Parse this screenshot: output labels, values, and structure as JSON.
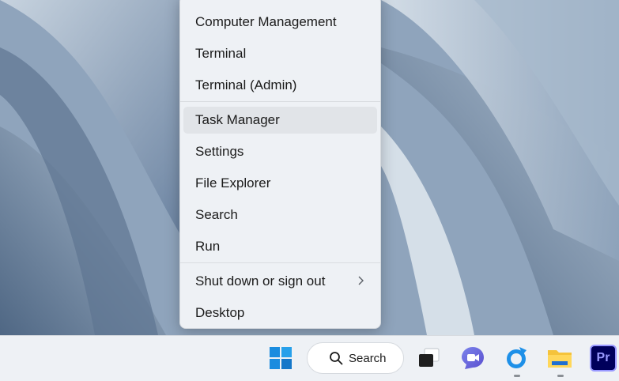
{
  "menu": {
    "items": [
      {
        "label": "Computer Management"
      },
      {
        "label": "Terminal"
      },
      {
        "label": "Terminal (Admin)"
      },
      {
        "label": "Task Manager"
      },
      {
        "label": "Settings"
      },
      {
        "label": "File Explorer"
      },
      {
        "label": "Search"
      },
      {
        "label": "Run"
      },
      {
        "label": "Shut down or sign out",
        "icon": "chevron-right-icon"
      },
      {
        "label": "Desktop"
      }
    ],
    "highlighted": "Task Manager"
  },
  "taskbar": {
    "search_label": "Search",
    "apps": [
      {
        "name": "start",
        "icon": "windows-logo-icon"
      },
      {
        "name": "task-view",
        "icon": "task-view-icon"
      },
      {
        "name": "teams",
        "icon": "video-chat-icon"
      },
      {
        "name": "edge",
        "icon": "browser-icon"
      },
      {
        "name": "file-explorer",
        "icon": "folder-icon"
      },
      {
        "name": "premiere",
        "icon": "premiere-pro-icon",
        "label": "Pr"
      }
    ],
    "accent_color": "#0f6cbd"
  }
}
